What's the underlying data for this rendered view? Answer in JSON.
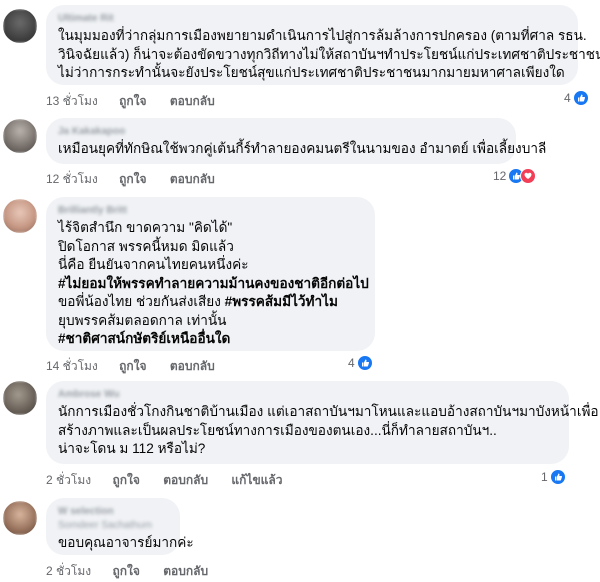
{
  "comments": [
    {
      "author": "Ultimate Rit",
      "lines": [
        "ในมุมมองที่ว่ากลุ่มการเมืองพยายามดำเนินการไปสู่การล้มล้างการปกครอง (ตามที่ศาล รธน.",
        "วินิจฉัยแล้ว) ก็น่าจะต้องขัดขวางทุกวิถีทางไม่ให้สถาบันฯทำประโยชน์แก่ประเทศชาติประชาชน",
        "ไม่ว่าการกระทำนั้นจะยังประโยชน์สุขแก่ประเทศชาติประชาชนมากมายมหาศาลเพียงใด"
      ],
      "time": "13 ชั่วโมง",
      "like": "ถูกใจ",
      "reply": "ตอบกลับ",
      "reaction_count": "4",
      "reactions": [
        "like"
      ]
    },
    {
      "author": "Ja Kakakapoo",
      "lines": [
        "เหมือนยุคที่ทักษิณใช้พวกคู่เต้นกี้ร์ทำลายองคมนตรีในนามของ อำมาตย์ เพื่อเลี้ยงบาลี"
      ],
      "time": "12 ชั่วโมง",
      "like": "ถูกใจ",
      "reply": "ตอบกลับ",
      "reaction_count": "12",
      "reactions": [
        "like",
        "love"
      ]
    },
    {
      "author": "Brilliantly Britt",
      "lines": [
        "ไร้จิตสำนึก ขาดความ \"คิดได้\"",
        "ปิดโอกาส พรรคนี้หมด มิดแล้ว",
        "นี่คือ ยืนยันจากคนไทยคนหนึ่งค่ะ",
        "#ไม่ยอมให้พรรคทำลายความม้านคงของชาติอีกต่อไป",
        "ขอพี่น้องไทย ช่วยกันส่งเสียง #พรรคส้มมีไว้ทำไม",
        "ยุบพรรคส้มตลอดกาล เท่านั้น",
        "#ชาติศาสน์กษัตริย์เหนืออื่นใด"
      ],
      "bold_lines": [
        3,
        6
      ],
      "time": "14 ชั่วโมง",
      "like": "ถูกใจ",
      "reply": "ตอบกลับ",
      "reaction_count": "4",
      "reactions": [
        "like"
      ]
    },
    {
      "author": "Ambrose Wu",
      "lines": [
        "นักการเมืองชั่วโกงกินชาติบ้านเมือง แต่เอาสถาบันฯมาโหนและแอบอ้างสถาบันฯมาบังหน้าเพื่อ",
        "สร้างภาพและเป็นผลประโยชน์ทางการเมืองของตนเอง...นี่ก็ทำลายสถาบันฯ..",
        "น่าจะโดน ม 112 หรือไม่?"
      ],
      "time": "2 ชั่วโมง",
      "like": "ถูกใจ",
      "reply": "ตอบกลับ",
      "edited": "แก้ไขแล้ว",
      "reaction_count": "1",
      "reactions": [
        "like"
      ]
    },
    {
      "author": "W selection",
      "author_sub": "Somdeer Sachathum",
      "lines": [
        "ขอบคุณอาจารย์มากค่ะ"
      ],
      "time": "2 ชั่วโมง",
      "like": "ถูกใจ",
      "reply": "ตอบกลับ"
    }
  ],
  "colors": {
    "bubble": "#f0f2f5",
    "meta": "#65676b",
    "like": "#1877f2",
    "love": "#f33e58"
  }
}
